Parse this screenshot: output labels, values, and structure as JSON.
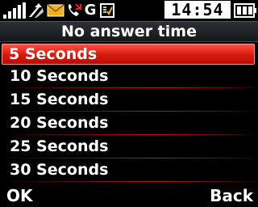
{
  "status_bar": {
    "network_label": "G",
    "time": "14:54"
  },
  "screen": {
    "title": "No answer time"
  },
  "options": [
    {
      "label": "5 Seconds",
      "selected": true
    },
    {
      "label": "10 Seconds",
      "selected": false
    },
    {
      "label": "15 Seconds",
      "selected": false
    },
    {
      "label": "20 Seconds",
      "selected": false
    },
    {
      "label": "25 Seconds",
      "selected": false
    },
    {
      "label": "30 Seconds",
      "selected": false
    }
  ],
  "softkeys": {
    "left": "OK",
    "right": "Back"
  },
  "colors": {
    "selection": "#e42416",
    "divider": "#c41212",
    "envelope": "#f2b01e"
  }
}
